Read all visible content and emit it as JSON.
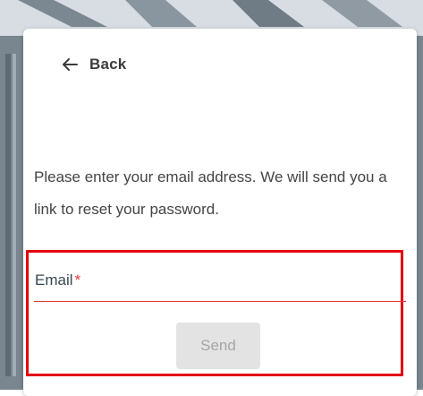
{
  "back": {
    "label": "Back",
    "icon": "arrow-left-icon"
  },
  "instructions": "Please enter your email address. We will send you a link to reset your password.",
  "email": {
    "label": "Email",
    "required_mark": "*",
    "value": ""
  },
  "send": {
    "label": "Send",
    "disabled": true
  },
  "colors": {
    "accent_error": "#e53935",
    "highlight_border": "#e3000f",
    "button_disabled_bg": "#e3e3e3",
    "button_disabled_text": "#a6a6a6"
  }
}
